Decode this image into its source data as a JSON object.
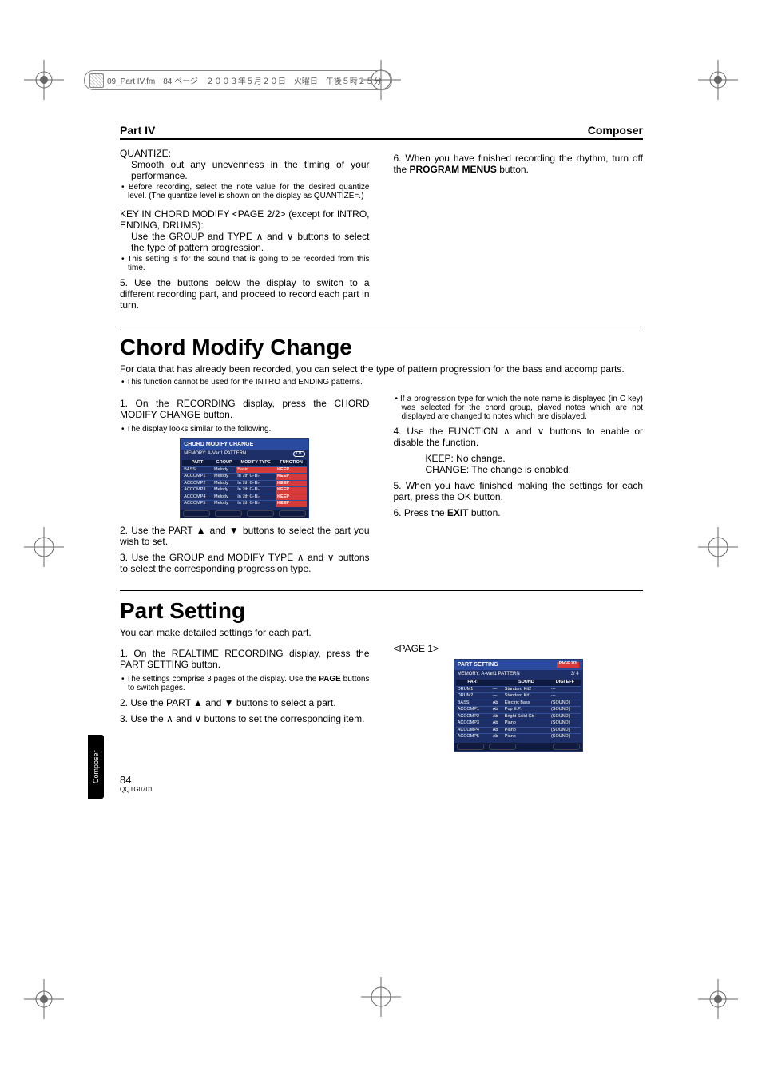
{
  "meta_header": "09_Part IV.fm　84 ページ　２００３年５月２０日　火曜日　午後５時２５分",
  "running_head": {
    "left": "Part IV",
    "right": "Composer"
  },
  "side_tab": "Composer",
  "section1": {
    "quantize_label": "QUANTIZE:",
    "quantize_body": "Smooth out any unevenness in the timing of your performance.",
    "quantize_note": "Before recording, select the note value for the desired quantize level. (The quantize level is shown on the display as QUANTIZE=.)",
    "keyin_head": "KEY IN CHORD MODIFY <PAGE 2/2> (except for INTRO, ENDING, DRUMS):",
    "keyin_body": "Use the GROUP and TYPE ∧ and ∨ buttons to select the type of pattern progression.",
    "keyin_note": "This setting is for the sound that is going to be recorded from this time.",
    "step5": "Use the buttons below the display to switch to a different recording part, and proceed to record each part in turn.",
    "step6_pre": "When you have finished recording the rhythm, turn off the ",
    "step6_bold": "PROGRAM MENUS",
    "step6_post": " button."
  },
  "section2": {
    "title": "Chord Modify Change",
    "lead": "For data that has already been recorded, you can select the type of pattern progression for the bass and accomp parts.",
    "lead_note": "This function cannot be used for the INTRO and ENDING patterns.",
    "step1": "On the RECORDING display, press the CHORD MODIFY CHANGE button.",
    "step1_note": "The display looks similar to the following.",
    "step2": "Use the PART ▲ and ▼ buttons to select the part you wish to set.",
    "step3": "Use the GROUP and MODIFY TYPE ∧ and ∨ buttons to select the corresponding progression type.",
    "step3_note": "If a progression type for which the note name is displayed (in C key) was selected for the chord group, played notes which are not displayed are changed to notes which are displayed.",
    "step4": "Use the FUNCTION ∧ and ∨ buttons to enable or disable the function.",
    "step4_keep": "KEEP: No change.",
    "step4_change": "CHANGE: The change is enabled.",
    "step5": "When you have finished making the settings for each part, press the OK button.",
    "step6_pre": "Press the ",
    "step6_bold": "EXIT",
    "step6_post": " button.",
    "lcd": {
      "title": "CHORD MODIFY CHANGE",
      "mem": "MEMORY: A-Vari1 PATTERN",
      "ok": "OK",
      "cols": [
        "PART",
        "GROUP",
        "MODIFY TYPE",
        "FUNCTION"
      ],
      "rows": [
        [
          "BASS",
          "Melody",
          "Basic",
          "KEEP"
        ],
        [
          "ACCOMP1",
          "Melody",
          "In 7th G-B♭",
          "KEEP"
        ],
        [
          "ACCOMP2",
          "Melody",
          "In 7th G-B♭",
          "KEEP"
        ],
        [
          "ACCOMP3",
          "Melody",
          "In 7th G-B♭",
          "KEEP"
        ],
        [
          "ACCOMP4",
          "Melody",
          "In 7th G-B♭",
          "KEEP"
        ],
        [
          "ACCOMP5",
          "Melody",
          "In 7th G-B♭",
          "KEEP"
        ]
      ]
    }
  },
  "section3": {
    "title": "Part Setting",
    "lead": "You can make detailed settings for each part.",
    "step1": "On the REALTIME RECORDING display, press the PART SETTING button.",
    "step1_note_a": "The settings comprise 3 pages of the display. Use the ",
    "step1_note_bold": "PAGE",
    "step1_note_b": " buttons to switch pages.",
    "step2": "Use the PART ▲ and ▼ buttons to select a part.",
    "step3": "Use the ∧ and ∨ buttons to set the corresponding item.",
    "page_label": "<PAGE 1>",
    "lcd": {
      "title": "PART SETTING",
      "page": "PAGE 1/3",
      "mem": "MEMORY: A-Vari1 PATTERN",
      "time": "3/ 4",
      "cols": [
        "PART",
        "",
        "SOUND",
        "DIGI EFF"
      ],
      "rows": [
        [
          "DRUM1",
          "—",
          "Standard Kit2",
          "---"
        ],
        [
          "DRUM2",
          "—",
          "Standard Kit1",
          "---"
        ],
        [
          "BASS",
          "Ab",
          "Electric Bass",
          "(SOUND)"
        ],
        [
          "ACCOMP1",
          "Ab",
          "Pop E.P.",
          "(SOUND)"
        ],
        [
          "ACCOMP2",
          "Ab",
          "Bright Solid Gtr",
          "(SOUND)"
        ],
        [
          "ACCOMP3",
          "Ab",
          "Piano",
          "(SOUND)"
        ],
        [
          "ACCOMP4",
          "Ab",
          "Piano",
          "(SOUND)"
        ],
        [
          "ACCOMP5",
          "Ab",
          "Piano",
          "(SOUND)"
        ]
      ]
    }
  },
  "footer": {
    "page": "84",
    "code": "QQTG0701"
  }
}
